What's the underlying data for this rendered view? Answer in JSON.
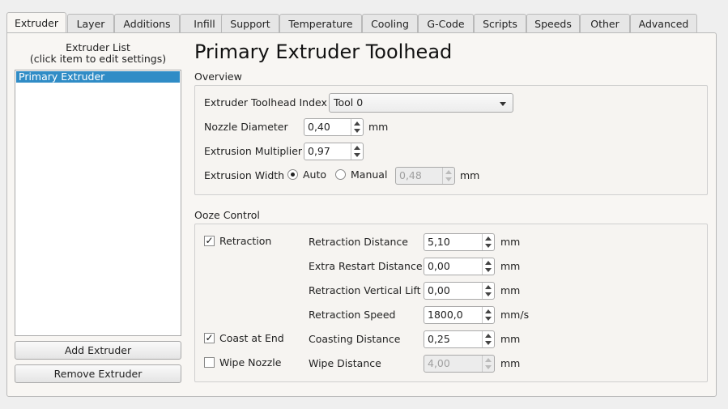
{
  "tabs": [
    "Extruder",
    "Layer",
    "Additions",
    "Infill",
    "Support",
    "Temperature",
    "Cooling",
    "G-Code",
    "Scripts",
    "Speeds",
    "Other",
    "Advanced"
  ],
  "active_tab": "Extruder",
  "extruder_list": {
    "caption_line1": "Extruder List",
    "caption_line2": "(click item to edit settings)",
    "items": [
      "Primary Extruder"
    ],
    "selected": "Primary Extruder",
    "add_label": "Add Extruder",
    "remove_label": "Remove Extruder"
  },
  "page_title": "Primary Extruder Toolhead",
  "overview": {
    "label": "Overview",
    "toolhead_index_label": "Extruder Toolhead Index",
    "toolhead_index_value": "Tool 0",
    "nozzle_label": "Nozzle Diameter",
    "nozzle_value": "0,40",
    "nozzle_unit": "mm",
    "multiplier_label": "Extrusion Multiplier",
    "multiplier_value": "0,97",
    "width_label": "Extrusion Width",
    "auto_label": "Auto",
    "manual_label": "Manual",
    "width_value": "0,48",
    "width_unit": "mm",
    "width_mode": "Auto"
  },
  "ooze": {
    "label": "Ooze Control",
    "retraction_label": "Retraction",
    "retraction_checked": true,
    "coast_label": "Coast at End",
    "coast_checked": true,
    "wipe_label": "Wipe Nozzle",
    "wipe_checked": false,
    "fields": [
      {
        "label": "Retraction Distance",
        "value": "5,10",
        "unit": "mm",
        "enabled": true
      },
      {
        "label": "Extra Restart Distance",
        "value": "0,00",
        "unit": "mm",
        "enabled": true
      },
      {
        "label": "Retraction Vertical Lift",
        "value": "0,00",
        "unit": "mm",
        "enabled": true
      },
      {
        "label": "Retraction Speed",
        "value": "1800,0",
        "unit": "mm/s",
        "enabled": true
      },
      {
        "label": "Coasting Distance",
        "value": "0,25",
        "unit": "mm",
        "enabled": true
      },
      {
        "label": "Wipe Distance",
        "value": "4,00",
        "unit": "mm",
        "enabled": false
      }
    ]
  },
  "colors": {
    "selection": "#308cc6"
  }
}
